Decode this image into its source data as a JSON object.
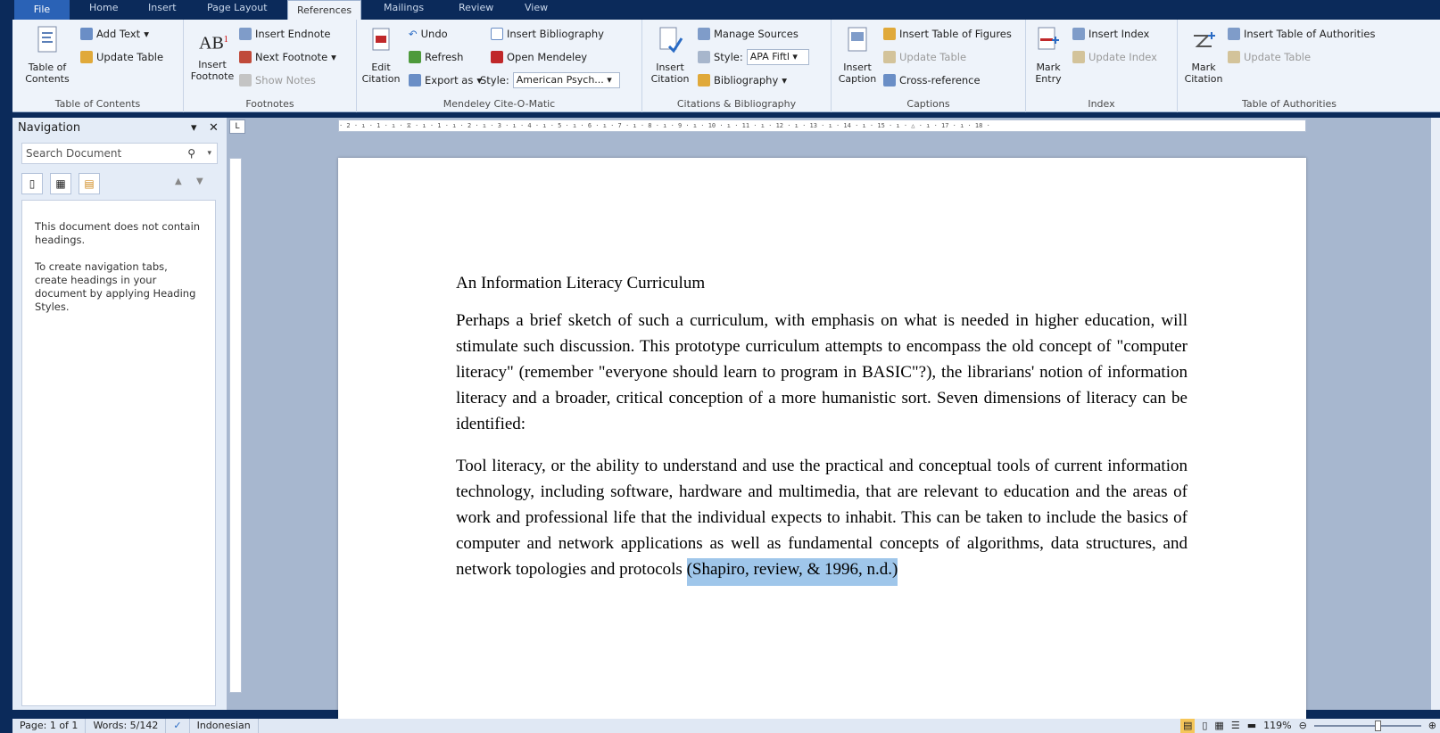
{
  "tabs": [
    "File",
    "Home",
    "Insert",
    "Page Layout",
    "References",
    "Mailings",
    "Review",
    "View"
  ],
  "ribbon": {
    "toc": {
      "big": "Table of Contents",
      "add_text": "Add Text",
      "update_table": "Update Table",
      "label": "Table of Contents"
    },
    "footnotes": {
      "big": "Insert Footnote",
      "insert_endnote": "Insert Endnote",
      "next_footnote": "Next Footnote",
      "show_notes": "Show Notes",
      "label": "Footnotes"
    },
    "mendeley": {
      "edit_citation": "Edit Citation",
      "undo": "Undo",
      "refresh": "Refresh",
      "export_as": "Export as",
      "insert_bibliography": "Insert Bibliography",
      "open_mendeley": "Open Mendeley",
      "style_label": "Style:",
      "style_value": "American Psych...",
      "label": "Mendeley Cite-O-Matic"
    },
    "citations": {
      "insert_citation": "Insert Citation",
      "manage_sources": "Manage Sources",
      "style_label": "Style:",
      "style_value": "APA Fiftl",
      "bibliography": "Bibliography",
      "label": "Citations & Bibliography"
    },
    "captions": {
      "insert_caption": "Insert Caption",
      "insert_table_of_figures": "Insert Table of Figures",
      "update_table": "Update Table",
      "cross_reference": "Cross-reference",
      "label": "Captions"
    },
    "index": {
      "mark_entry": "Mark Entry",
      "insert_index": "Insert Index",
      "update_index": "Update Index",
      "label": "Index"
    },
    "toa": {
      "mark_citation": "Mark Citation",
      "insert_toa": "Insert Table of Authorities",
      "update_table": "Update Table",
      "label": "Table of Authorities"
    }
  },
  "navigation": {
    "title": "Navigation",
    "search_placeholder": "Search Document",
    "msg1": "This document does not contain headings.",
    "msg2": "To create navigation tabs, create headings in your document by applying Heading Styles."
  },
  "ruler": "· 2 · ı · 1 · ı · ⧖ · ı · 1 · ı · 2 · ı · 3 · ı · 4 · ı · 5 · ı · 6 · ı · 7 · ı · 8 · ı · 9 · ı · 10 · ı · 11 · ı · 12 · ı · 13 · ı · 14 · ı · 15 · ı · △ · ı · 17 · ı · 18 ·",
  "document": {
    "title": "An Information Literacy Curriculum",
    "p1": "Perhaps a brief sketch of such a curriculum, with emphasis on what is needed in higher education, will stimulate such discussion. This prototype curriculum attempts to encompass the old concept of \"computer literacy\" (remember \"everyone should learn to program in BASIC\"?), the librarians' notion of information literacy and a broader, critical conception of a more humanistic sort. Seven dimensions of literacy can be identified:",
    "p2": "Tool literacy, or the ability to understand and use the practical and conceptual tools of current information technology, including software, hardware and multimedia, that are relevant to education and the areas of work and professional life that the individual expects to inhabit. This can be taken to include the basics of computer and network applications as well as fundamental concepts of algorithms, data structures, and network topologies and protocols",
    "citation": "(Shapiro, review, & 1996, n.d.)"
  },
  "status": {
    "page": "Page: 1 of 1",
    "words": "Words: 5/142",
    "language": "Indonesian",
    "zoom": "119%"
  },
  "colors": {
    "titlebar": "#0b2a5a",
    "ribbon": "#eef3fa",
    "selection": "#9fc6ea",
    "workspace": "#a7b7cf"
  }
}
